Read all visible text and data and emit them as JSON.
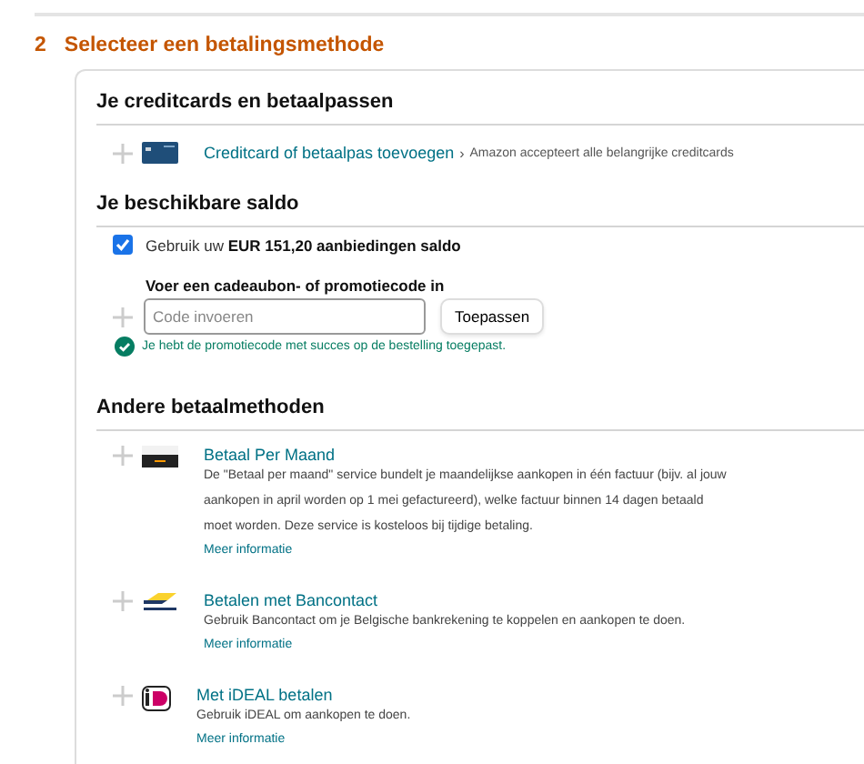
{
  "step": {
    "number": "2",
    "title": "Selecteer een betalingsmethode"
  },
  "cards_section": {
    "heading": "Je creditcards en betaalpassen",
    "add": {
      "kind": "card",
      "link": "Creditcard of betaalpas toevoegen",
      "chevron": "›",
      "note": "Amazon accepteert alle belangrijke creditcards"
    }
  },
  "balance_section": {
    "heading": "Je beschikbare saldo",
    "use_balance": {
      "checked": true,
      "label": "Gebruik uw **EUR 151,20 aanbiedingen saldo**"
    },
    "promo": {
      "label": "Voer een cadeaubon- of promotiecode in",
      "placeholder": "Code invoeren",
      "button": "Toepassen",
      "success": "Je hebt de promotiecode met succes op de bestelling toegepast."
    }
  },
  "other_section": {
    "heading": "Andere betaalmethoden",
    "methods": [
      {
        "kind": "monthly",
        "title": "Betaal Per Maand",
        "description": "De \"Betaal per maand\" service bundelt je maandelijkse aankopen in één factuur (bijv. al jouw aankopen in april worden op 1 mei gefactureerd), welke factuur binnen 14 dagen betaald moet worden. Deze service is kosteloos bij tijdige betaling.",
        "link": "Meer informatie"
      },
      {
        "kind": "bancontact",
        "title": "Betalen met Bancontact",
        "description": "Gebruik Bancontact om je Belgische bankrekening te koppelen en aankopen te doen.",
        "link": "Meer informatie"
      },
      {
        "kind": "ideal",
        "title": "Met iDEAL betalen",
        "description": "Gebruik iDEAL om aankopen te doen.",
        "link": "Meer informatie"
      }
    ]
  }
}
